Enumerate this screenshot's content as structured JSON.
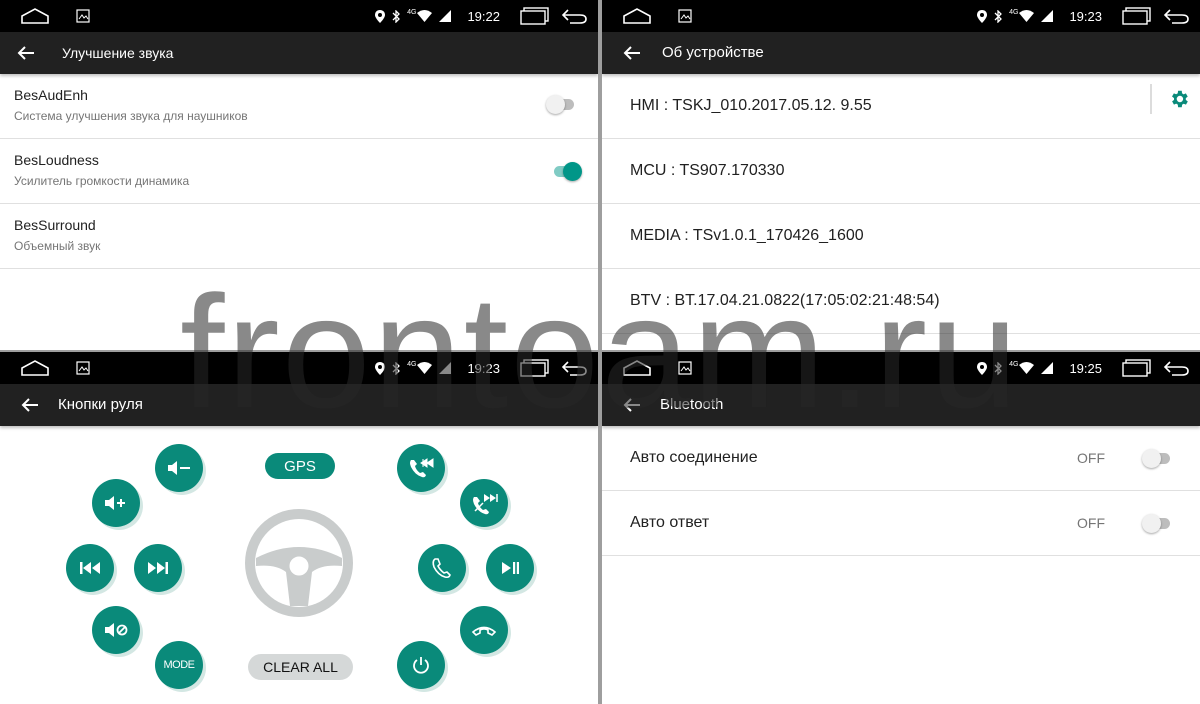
{
  "status_bars": {
    "top_left": {
      "time": "19:22"
    },
    "top_right": {
      "time": "19:23"
    },
    "bottom_left": {
      "time": "19:23"
    },
    "bottom_right": {
      "time": "19:25"
    },
    "network_label": "4G",
    "icons": [
      "home-icon",
      "gallery-icon",
      "location-icon",
      "bluetooth-icon",
      "wifi-icon",
      "signal-icon",
      "recent-apps-icon",
      "back-nav-icon"
    ]
  },
  "sound_panel": {
    "title": "Улучшение звука",
    "items": [
      {
        "title": "BesAudEnh",
        "subtitle": "Система улучшения звука для наушников",
        "enabled": false
      },
      {
        "title": "BesLoudness",
        "subtitle": "Усилитель громкости динамика",
        "enabled": true
      },
      {
        "title": "BesSurround",
        "subtitle": "Объемный звук"
      }
    ]
  },
  "device_panel": {
    "title": "Об устройстве",
    "items": [
      "HMI : TSKJ_010.2017.05.12. 9.55",
      "MCU : TS907.170330",
      "MEDIA : TSv1.0.1_170426_1600",
      "BTV : BT.17.04.21.0822(17:05:02:21:48:54)"
    ]
  },
  "steering_panel": {
    "title": "Кнопки руля",
    "gps_label": "GPS",
    "clear_label": "CLEAR ALL",
    "mode_label": "MODE",
    "buttons": [
      "volume-down",
      "volume-up",
      "prev-track",
      "next-track",
      "mute",
      "mode",
      "call-prev",
      "call-next",
      "answer-call",
      "play-pause",
      "hang-up",
      "power"
    ]
  },
  "bluetooth_panel": {
    "title": "Bluetooth",
    "items": [
      {
        "label": "Авто соединение",
        "state": "OFF",
        "enabled": false
      },
      {
        "label": "Авто ответ",
        "state": "OFF",
        "enabled": false
      }
    ]
  },
  "watermark": "frontoam.ru",
  "colors": {
    "accent": "#0a8a7a",
    "appbar": "#212121",
    "statusbar": "#000000",
    "toggle_on": "#009688"
  }
}
